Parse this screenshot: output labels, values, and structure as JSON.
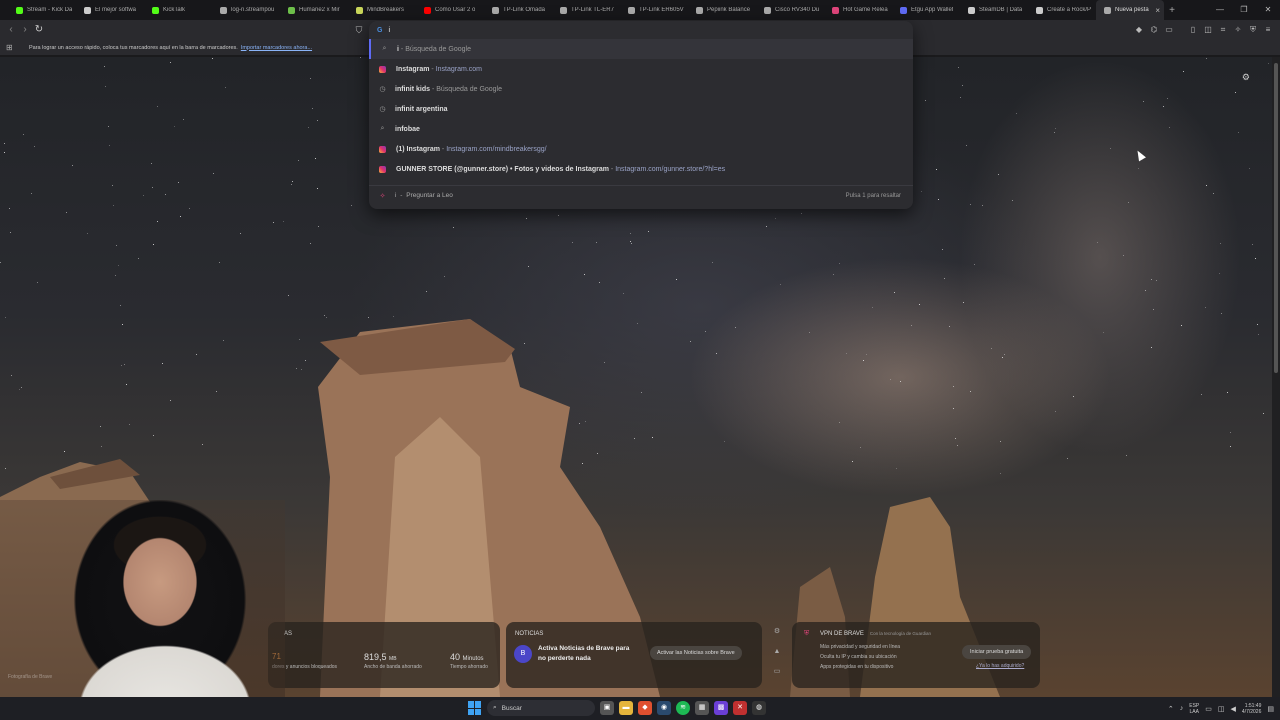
{
  "tabs": [
    {
      "label": "Stream - Kick Da",
      "color": "#53fc18"
    },
    {
      "label": "El mejor softwa",
      "color": "#cccccc"
    },
    {
      "label": "KickTalk",
      "color": "#53fc18"
    },
    {
      "label": "log-n.streampou",
      "color": "#aaaaaa"
    },
    {
      "label": "Humane2 x Mir",
      "color": "#6dbf4a"
    },
    {
      "label": "MindBreakers",
      "color": "#c9d65a"
    },
    {
      "label": "Como Usar 2 o",
      "color": "#ff0000"
    },
    {
      "label": "TP-Link Omada",
      "color": "#aaaaaa"
    },
    {
      "label": "TP-Link TL-ER7",
      "color": "#aaaaaa"
    },
    {
      "label": "TP-Link ER605V",
      "color": "#aaaaaa"
    },
    {
      "label": "Pepiink Balance",
      "color": "#aaaaaa"
    },
    {
      "label": "Cisco RV340 Du",
      "color": "#aaaaaa"
    },
    {
      "label": "Hot Game Relea",
      "color": "#e0457b"
    },
    {
      "label": "Etgu App Wallet",
      "color": "#5f6bf5"
    },
    {
      "label": "SteamDB | Data",
      "color": "#cccccc"
    },
    {
      "label": "Create a Rock/P",
      "color": "#cccccc"
    },
    {
      "label": "Nueva pesta",
      "color": "#aaaaaa",
      "active": true
    }
  ],
  "bookmarks_bar": {
    "text": "Para lograr un acceso rápido, coloca tus marcadores aquí en la barra de marcadores.",
    "link": "Importar marcadores ahora..."
  },
  "omnibox": {
    "input_value": "i",
    "suggestions": [
      {
        "icon": "search-icon",
        "bold": "i",
        "sep": " - ",
        "desc": "Búsqueda de Google",
        "url": ""
      },
      {
        "icon": "instagram-icon",
        "bold": "Instagram",
        "sep": " - ",
        "desc": "",
        "url": "Instagram.com"
      },
      {
        "icon": "history-icon",
        "bold": "infinit kids",
        "sep": " - ",
        "desc": "Búsqueda de Google",
        "url": ""
      },
      {
        "icon": "history-icon",
        "bold": "infinit argentina",
        "sep": "",
        "desc": "",
        "url": ""
      },
      {
        "icon": "search-icon",
        "bold": "infobae",
        "sep": "",
        "desc": "",
        "url": ""
      },
      {
        "icon": "instagram-icon",
        "bold": "(1) Instagram",
        "sep": " - ",
        "desc": "",
        "url": "Instagram.com/mindbreakersgg/"
      },
      {
        "icon": "instagram-icon",
        "bold": "GUNNER STORE (@gunner.store) • Fotos y videos de Instagram",
        "sep": " - ",
        "desc": "",
        "url": "Instagram.com/gunner.store/?hl=es"
      }
    ],
    "leo": {
      "query": "i",
      "label": "Preguntar a Leo",
      "hint": "Pulsa 1 para resaltar"
    }
  },
  "widgets": {
    "stats": {
      "heading": "AS",
      "trackers_value": "71",
      "trackers_label": "dores y anuncios bloqueados",
      "bandwidth_value": "819,5",
      "bandwidth_unit": "MB",
      "bandwidth_label": "Ancho de banda ahorrado",
      "time_value": "40",
      "time_unit": "Minutos",
      "time_label": "Tiempo ahorrado"
    },
    "news": {
      "heading": "NOTICIAS",
      "logo": "B",
      "message": "Activa Noticias de Brave para no perderte nada",
      "button": "Activar las Noticias sobre Brave"
    },
    "vpn": {
      "heading": "VPN DE BRAVE",
      "powered": "Con la tecnología de Guardian",
      "items": [
        "Más privacidad y seguridad en línea",
        "Oculta tu IP y cambia su ubicación",
        "Apps protegidas en tu dispositivo"
      ],
      "button": "Iniciar prueba gratuita",
      "link": "¿Ya lo has adquirido?"
    }
  },
  "webcam": {
    "tag": "Fotografía de Brave"
  },
  "taskbar": {
    "search_placeholder": "Buscar",
    "lang_top": "ESP",
    "lang_bottom": "LAA",
    "time": "1:51:49",
    "date": "4/7/2026"
  }
}
